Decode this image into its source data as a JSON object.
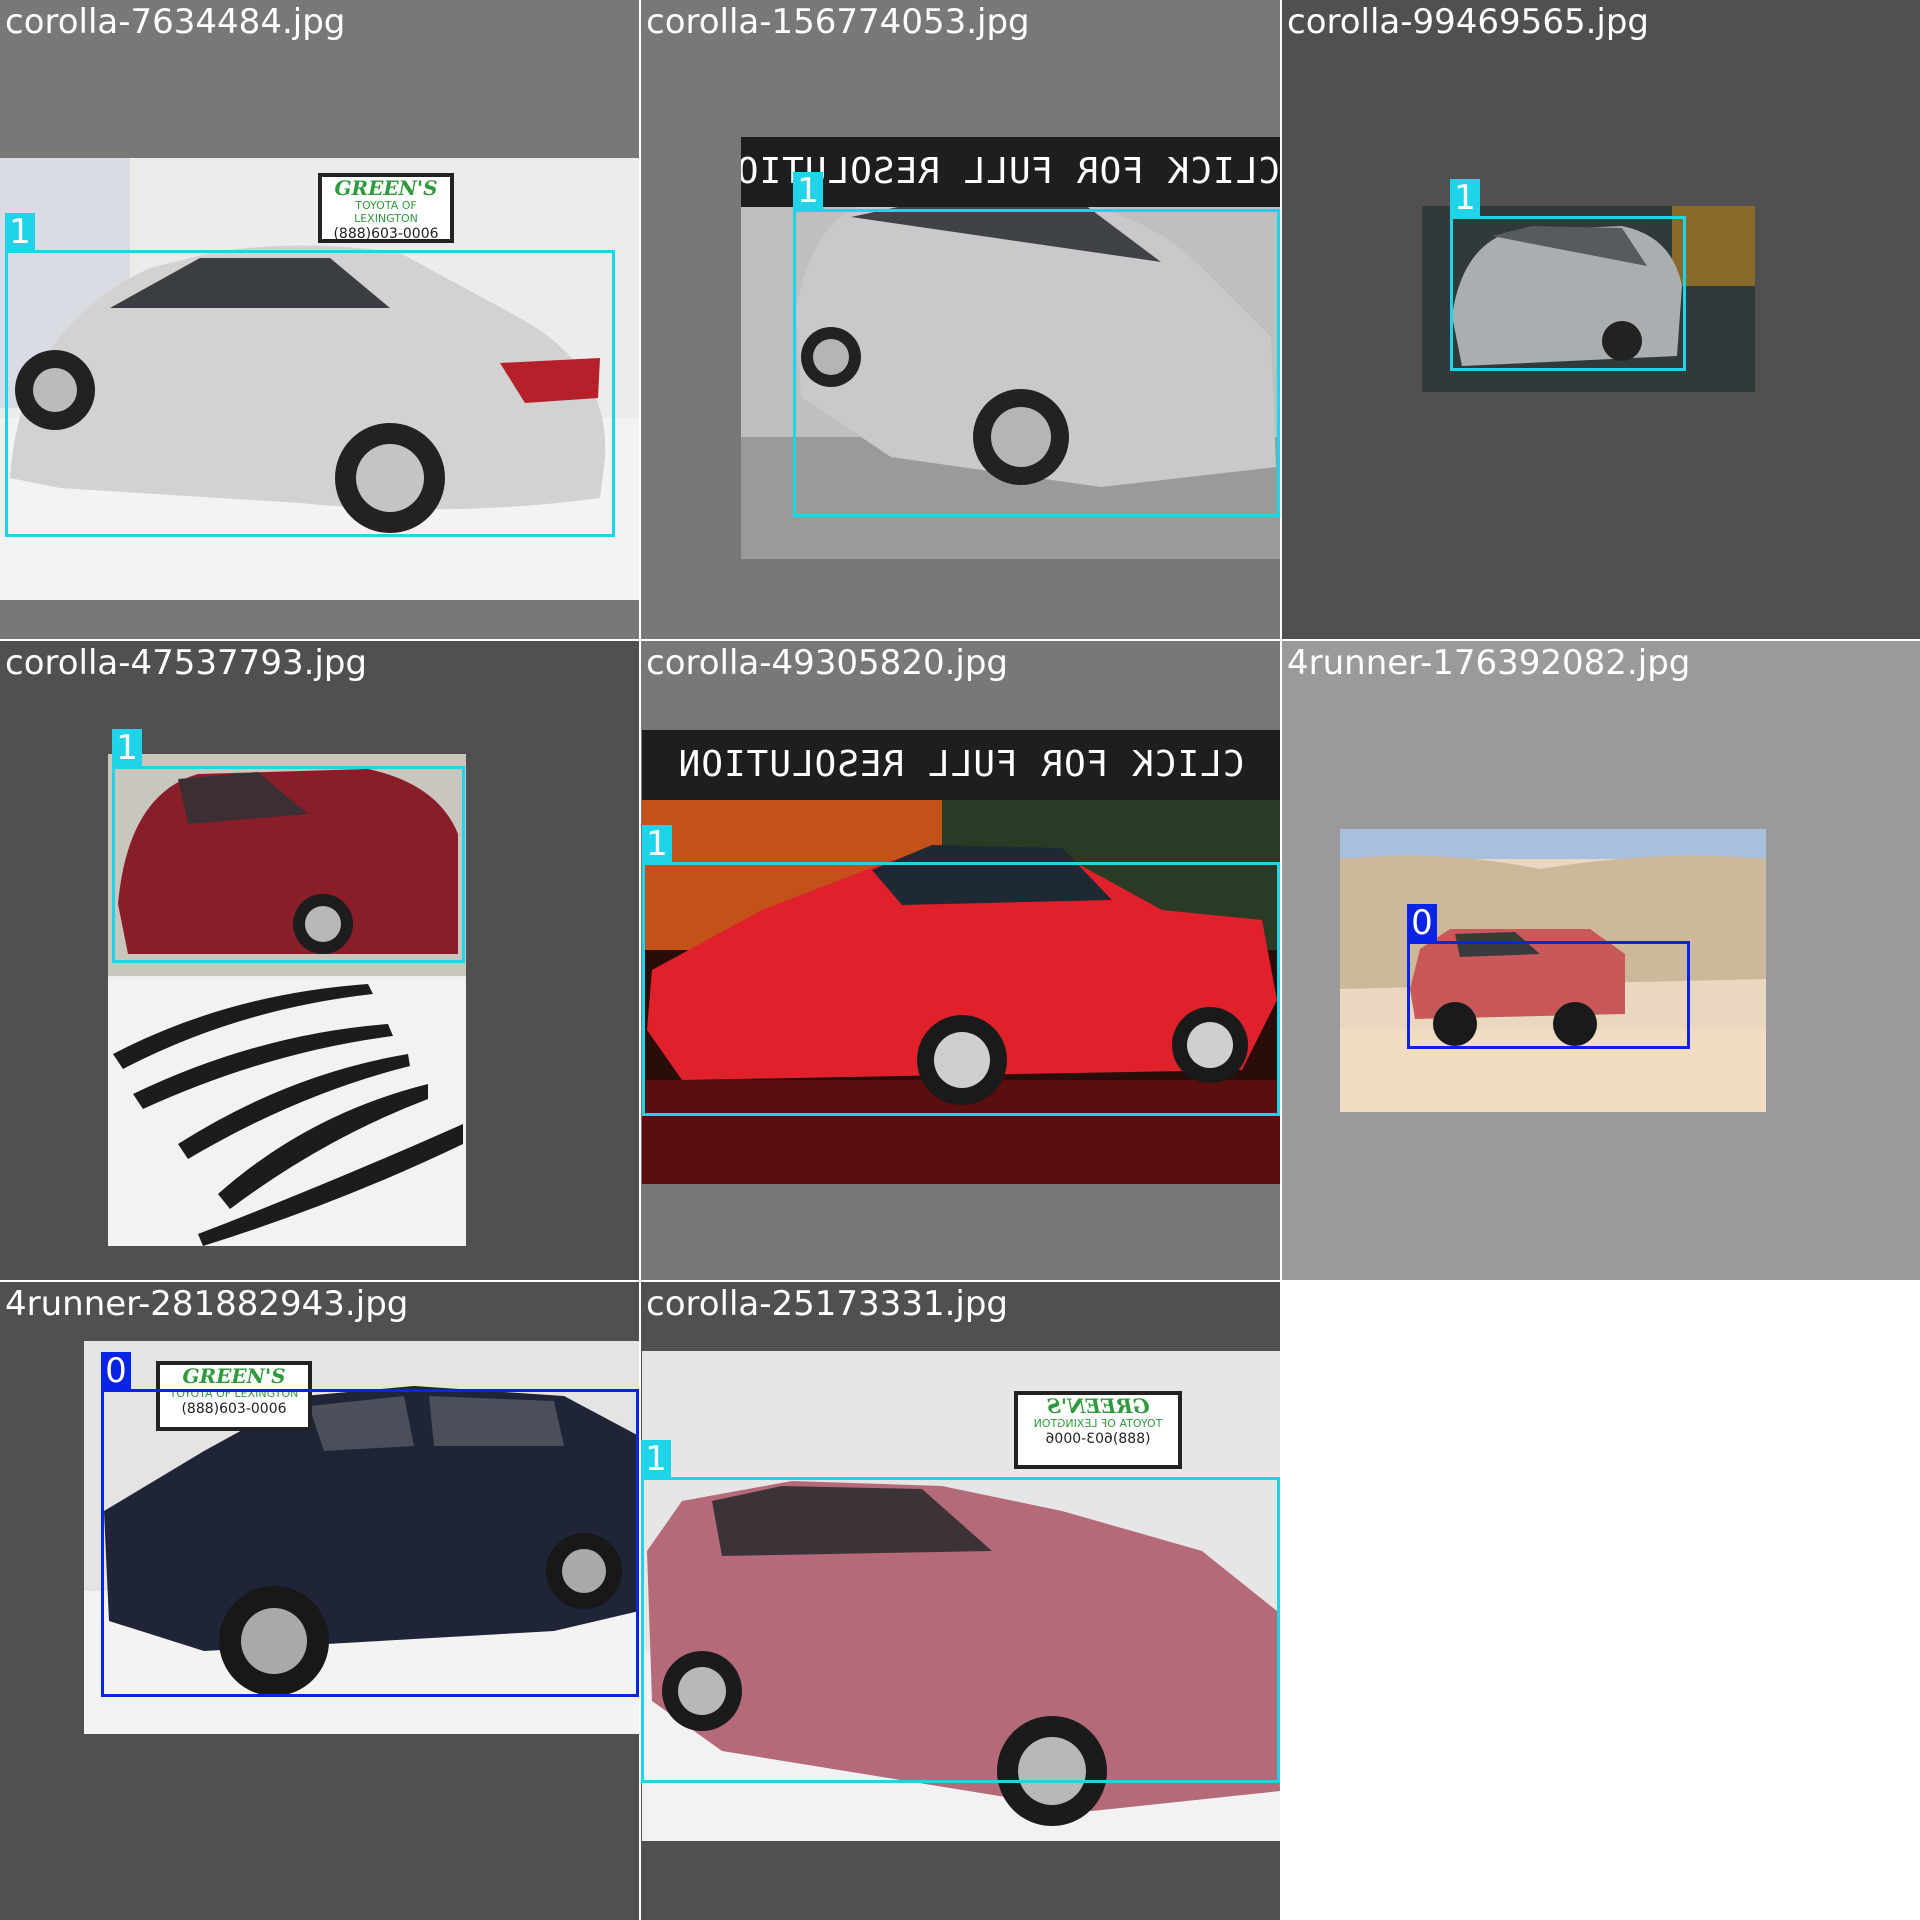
{
  "grid": {
    "tiles": [
      {
        "filename": "corolla-7634484.jpg",
        "box_label": "1",
        "sign": {
          "name": "GREEN'S",
          "dealer": "TOYOTA OF LEXINGTON",
          "phone": "(888)603-0006"
        }
      },
      {
        "filename": "corolla-156774053.jpg",
        "box_label": "1",
        "banner": "CLICK FOR FULL RESOLUTION"
      },
      {
        "filename": "corolla-99469565.jpg",
        "box_label": "1"
      },
      {
        "filename": "corolla-47537793.jpg",
        "box_label": "1"
      },
      {
        "filename": "corolla-49305820.jpg",
        "box_label": "1",
        "banner": "CLICK FOR FULL RESOLUTION"
      },
      {
        "filename": "4runner-176392082.jpg",
        "box_label": "0"
      },
      {
        "filename": "4runner-281882943.jpg",
        "box_label": "0",
        "sign": {
          "name": "GREEN'S",
          "dealer": "TOYOTA OF LEXINGTON",
          "phone": "(888)603-0006"
        }
      },
      {
        "filename": "corolla-25173331.jpg",
        "box_label": "1",
        "sign": {
          "name": "GREEN'S",
          "dealer": "TOYOTA OF LEXINGTON",
          "phone": "(888)603-0006"
        }
      }
    ]
  },
  "colors": {
    "class_0_box": "#0a24e6",
    "class_1_box": "#1fd3e8",
    "tile_bg_dark": "#505050",
    "tile_bg_mid": "#787878",
    "tile_bg_light": "#9a9a9a"
  }
}
